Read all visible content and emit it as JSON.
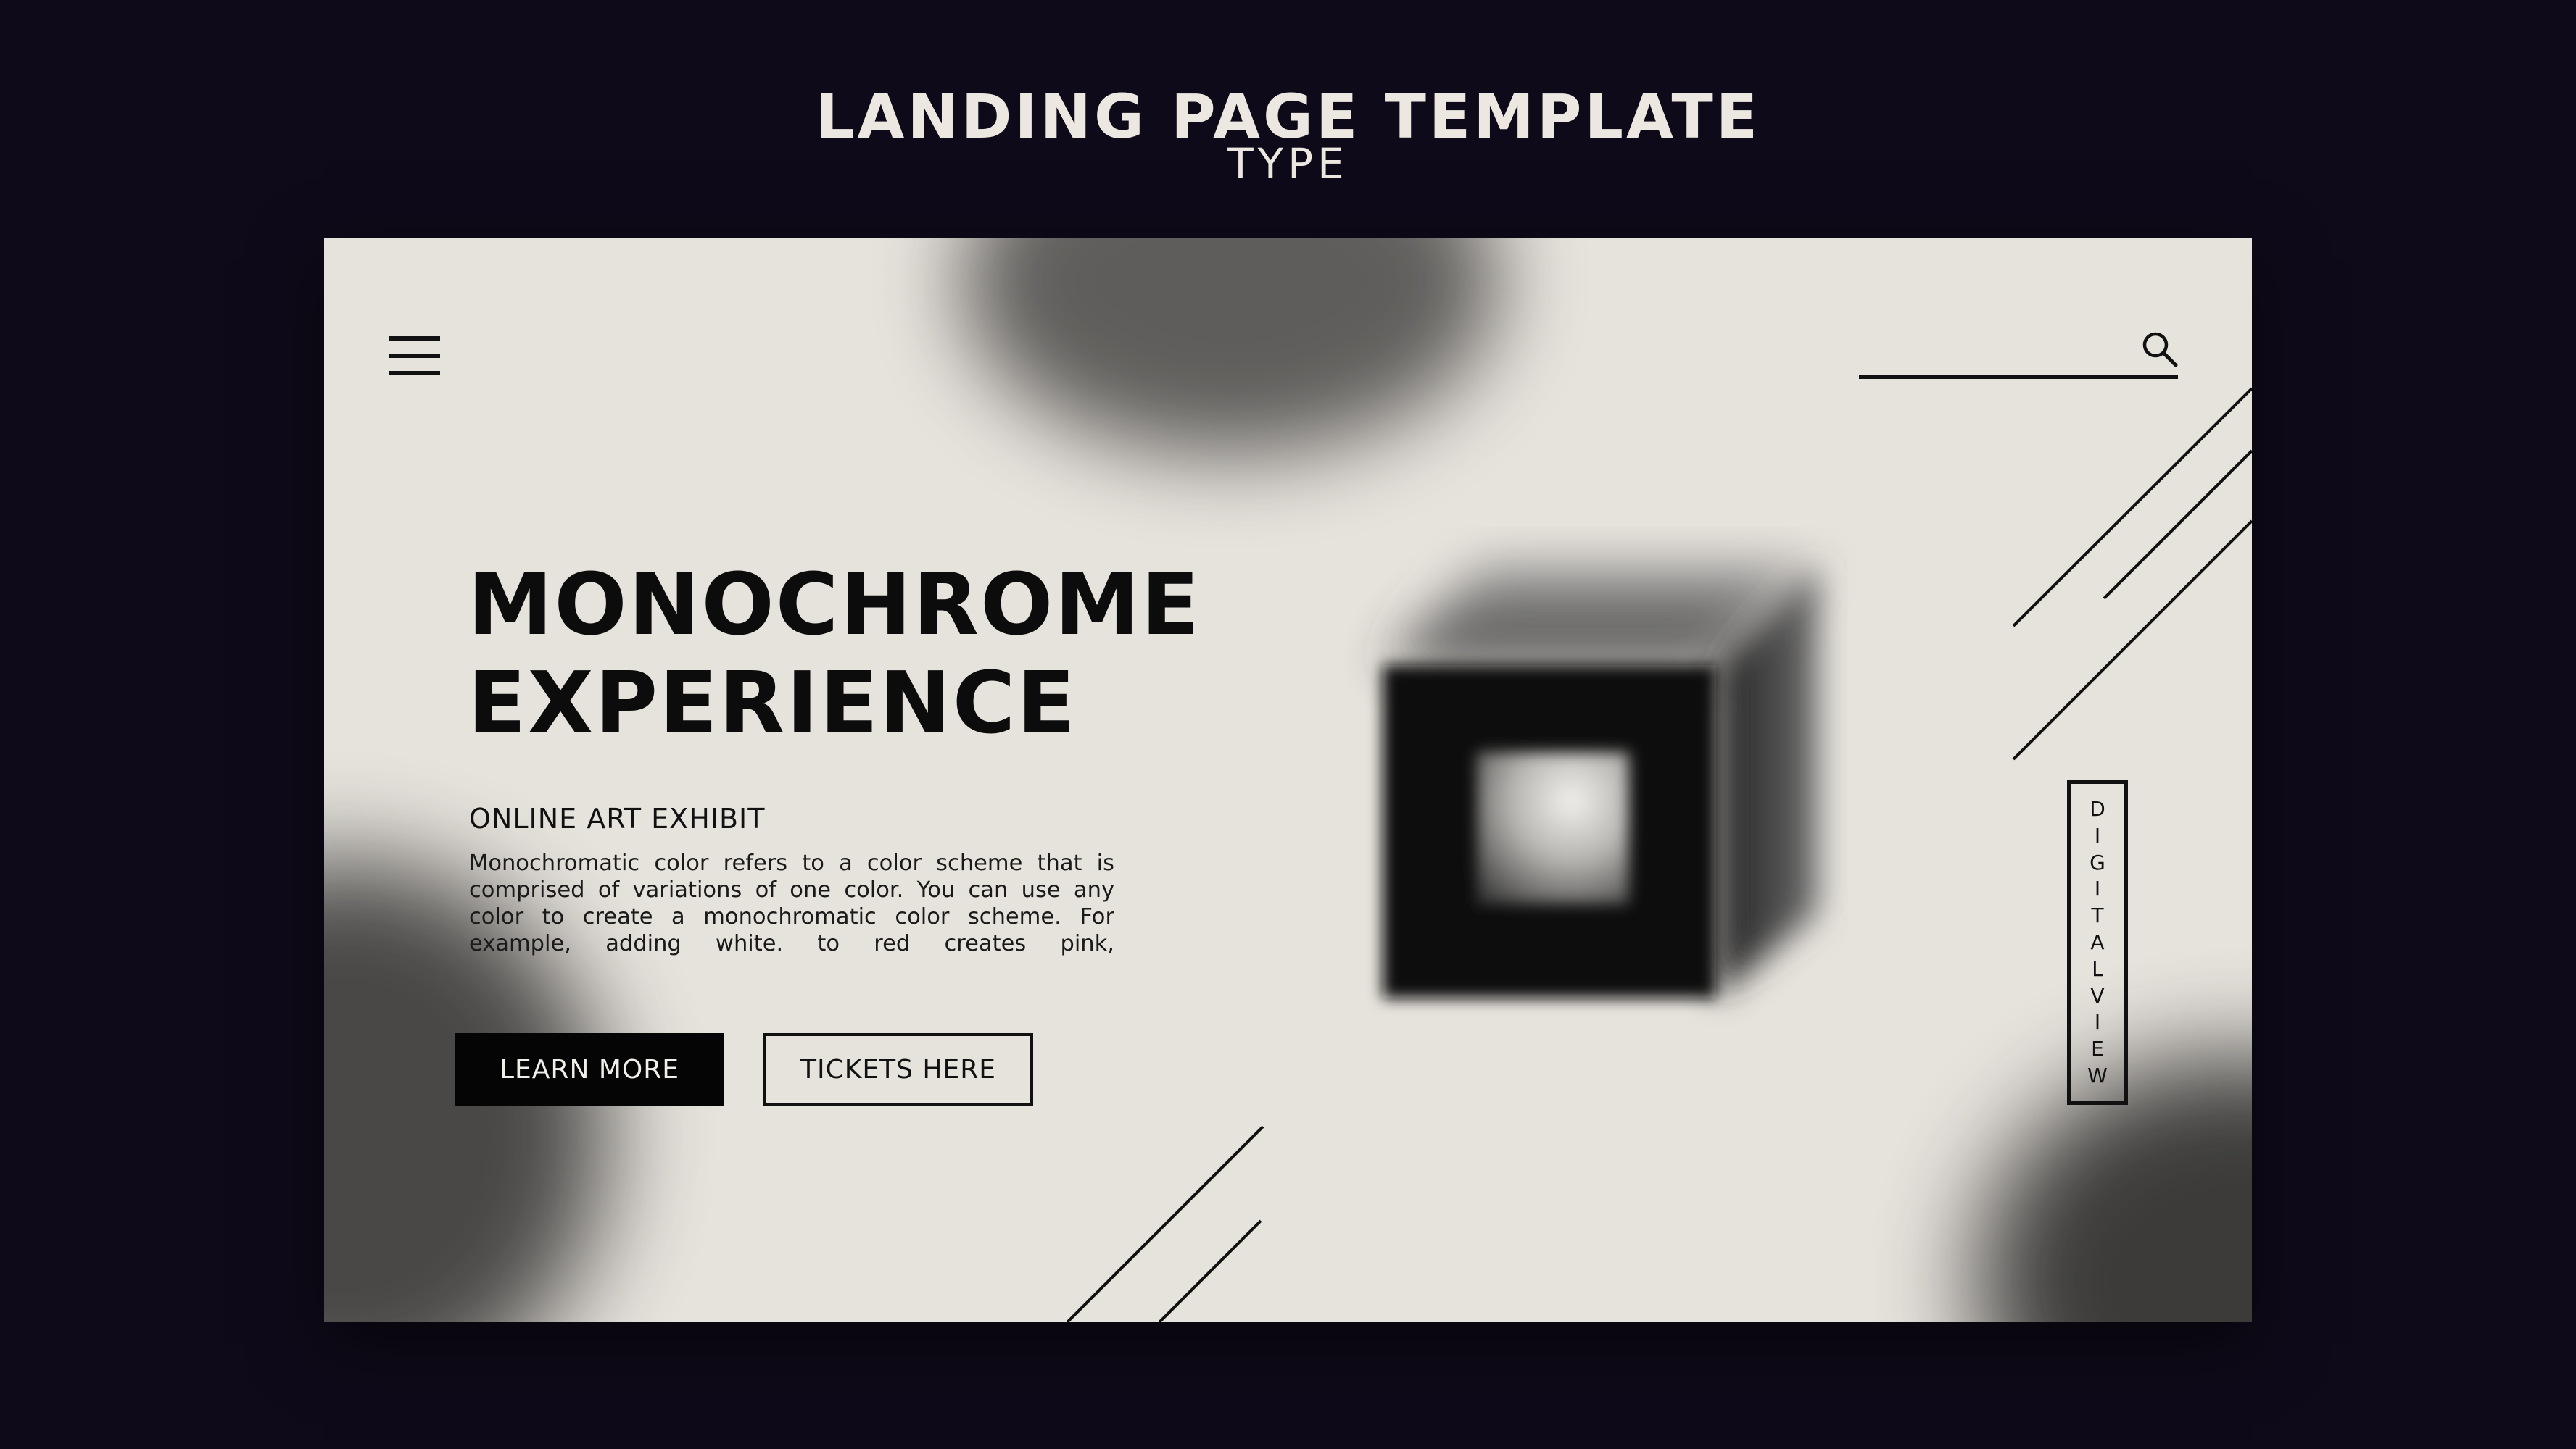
{
  "header": {
    "title": "LANDING PAGE TEMPLATE",
    "subtitle": "TYPE"
  },
  "nav": {
    "menu_icon": "hamburger-menu-icon",
    "search_icon": "search-icon",
    "search_value": ""
  },
  "hero": {
    "title_line1": "MONOCHROME",
    "title_line2": "EXPERIENCE",
    "subtitle": "ONLINE ART EXHIBIT",
    "body": "Monochromatic color refers to a color scheme that is comprised of variations of one color. You can use any color to create a monochromatic color scheme. For example, adding white. to red creates pink,"
  },
  "buttons": {
    "learn_more": "LEARN MORE",
    "tickets": "TICKETS HERE"
  },
  "side_label": {
    "letters": [
      "D",
      "I",
      "G",
      "I",
      "T",
      "A",
      "L",
      "V",
      "I",
      "E",
      "W"
    ]
  },
  "colors": {
    "background": "#0f0a19",
    "card": "#e6e2dc",
    "ink": "#0c0c0c",
    "header_text": "#ece8e1"
  }
}
